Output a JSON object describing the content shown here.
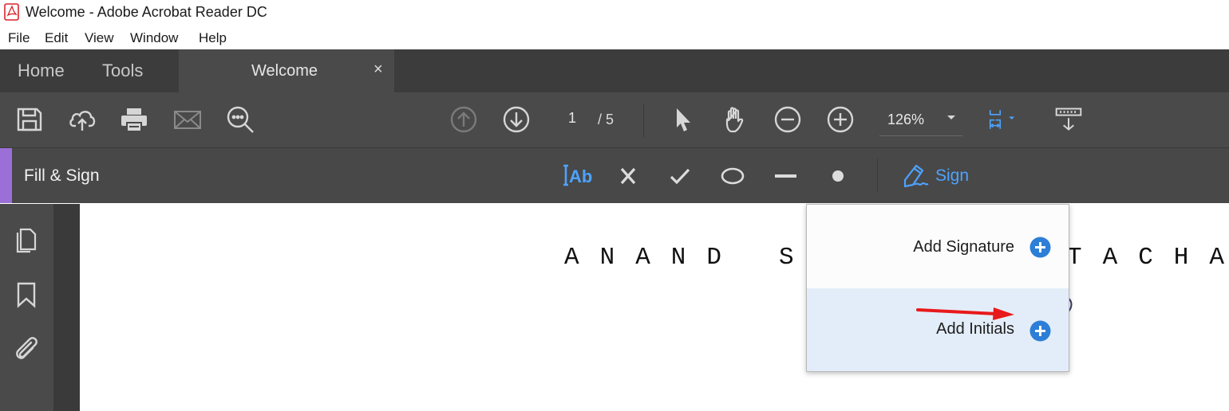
{
  "window": {
    "title": "Welcome - Adobe Acrobat Reader DC",
    "app_icon": "pdf-icon"
  },
  "menubar": {
    "items": [
      "File",
      "Edit",
      "View",
      "Window",
      "Help"
    ]
  },
  "tabs": {
    "home_label": "Home",
    "tools_label": "Tools",
    "document_tab_label": "Welcome",
    "close_symbol": "×"
  },
  "toolbar": {
    "icons": [
      "save-icon",
      "cloud-upload-icon",
      "print-icon",
      "email-icon",
      "search-icon",
      "page-up-icon",
      "page-down-icon",
      "select-pointer-icon",
      "hand-icon",
      "zoom-out-icon",
      "zoom-in-icon",
      "page-fit-icon",
      "read-mode-icon"
    ],
    "current_page": "1",
    "page_total": "/ 5",
    "zoom_value": "126%"
  },
  "fill_sign": {
    "title": "Fill & Sign",
    "tools": [
      "add-text-icon",
      "cross-mark-icon",
      "check-mark-icon",
      "ellipse-icon",
      "line-icon",
      "dot-icon"
    ],
    "sign_label": "Sign",
    "accent_color": "#9b6fd8",
    "sign_color": "#4da3ff"
  },
  "left_nav": {
    "icons": [
      "pages-icon",
      "bookmark-icon",
      "attachment-icon"
    ]
  },
  "document": {
    "visible_text_left": "ANAND",
    "visible_text_mid": "S",
    "visible_text_right": "TACHA"
  },
  "sign_menu": {
    "add_signature_label": "Add Signature",
    "add_initials_label": "Add Initials",
    "highlight_color": "#e3edf9",
    "plus_color": "#2d7ed6"
  },
  "annotation": {
    "arrow_color": "#e8191b"
  }
}
